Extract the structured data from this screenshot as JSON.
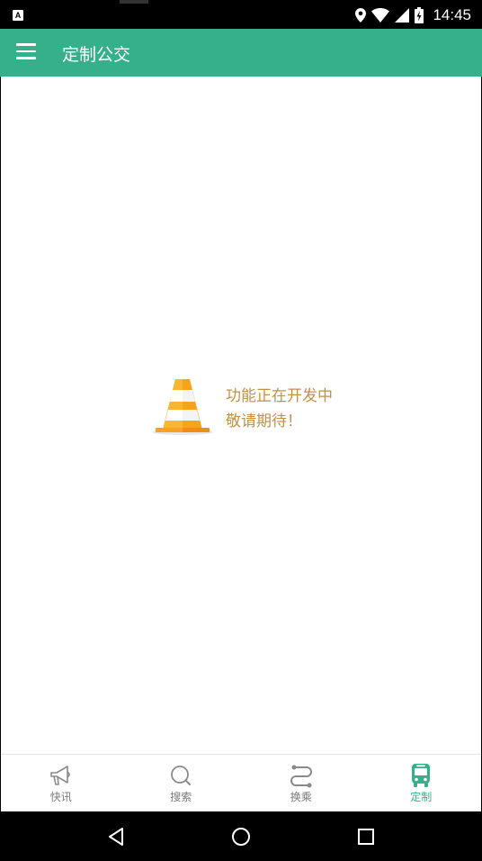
{
  "status_bar": {
    "time": "14:45",
    "icons": [
      "location-icon",
      "wifi-icon",
      "signal-icon",
      "battery-charging-icon"
    ],
    "notification": "A"
  },
  "app_bar": {
    "title": "定制公交",
    "color": "#35b08a"
  },
  "placeholder": {
    "line1": "功能正在开发中",
    "line2": "敬请期待！",
    "color": "#c39046"
  },
  "bottom_nav": {
    "items": [
      {
        "label": "快讯",
        "icon": "megaphone-icon",
        "active": false
      },
      {
        "label": "搜索",
        "icon": "search-icon",
        "active": false
      },
      {
        "label": "换乘",
        "icon": "transfer-route-icon",
        "active": false
      },
      {
        "label": "定制",
        "icon": "bus-icon",
        "active": true
      }
    ]
  }
}
